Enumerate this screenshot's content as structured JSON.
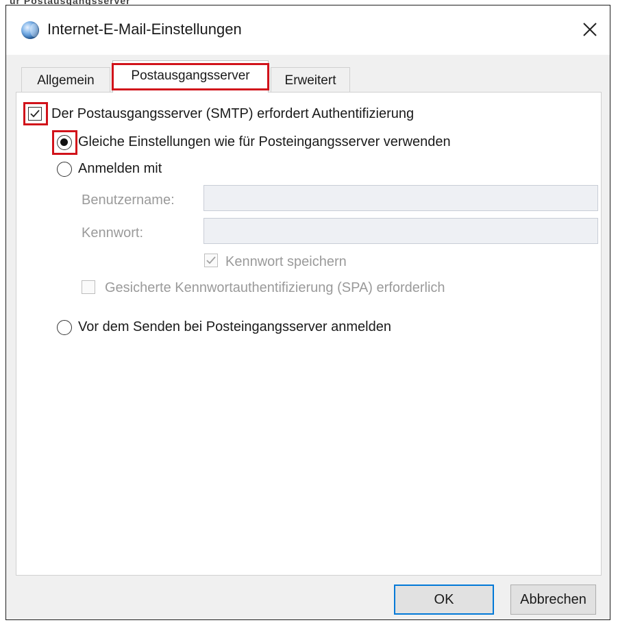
{
  "top_strip_fragment": "ür Postausgangsserver",
  "window": {
    "title": "Internet-E-Mail-Einstellungen",
    "icon": "globe-icon",
    "close": "close-icon"
  },
  "tabs": [
    {
      "label": "Allgemein",
      "selected": false
    },
    {
      "label": "Postausgangsserver",
      "selected": true
    },
    {
      "label": "Erweitert",
      "selected": false
    }
  ],
  "smtp_auth": {
    "label": "Der Postausgangsserver (SMTP) erfordert Authentifizierung",
    "checked": true
  },
  "options": {
    "same_settings": "Gleiche Einstellungen wie für Posteingangsserver verwenden",
    "login_with": "Anmelden mit",
    "login_before_send": "Vor dem Senden bei Posteingangsserver anmelden",
    "selected": "same_settings"
  },
  "credentials": {
    "username_label": "Benutzername:",
    "username_value": "",
    "password_label": "Kennwort:",
    "password_value": "",
    "remember_password": "Kennwort speichern",
    "remember_password_checked": true,
    "spa": "Gesicherte Kennwortauthentifizierung (SPA) erforderlich",
    "spa_checked": false
  },
  "buttons": {
    "ok": "OK",
    "cancel": "Abbrechen"
  },
  "highlight_color": "#d1121a",
  "accent_color": "#0078d7"
}
